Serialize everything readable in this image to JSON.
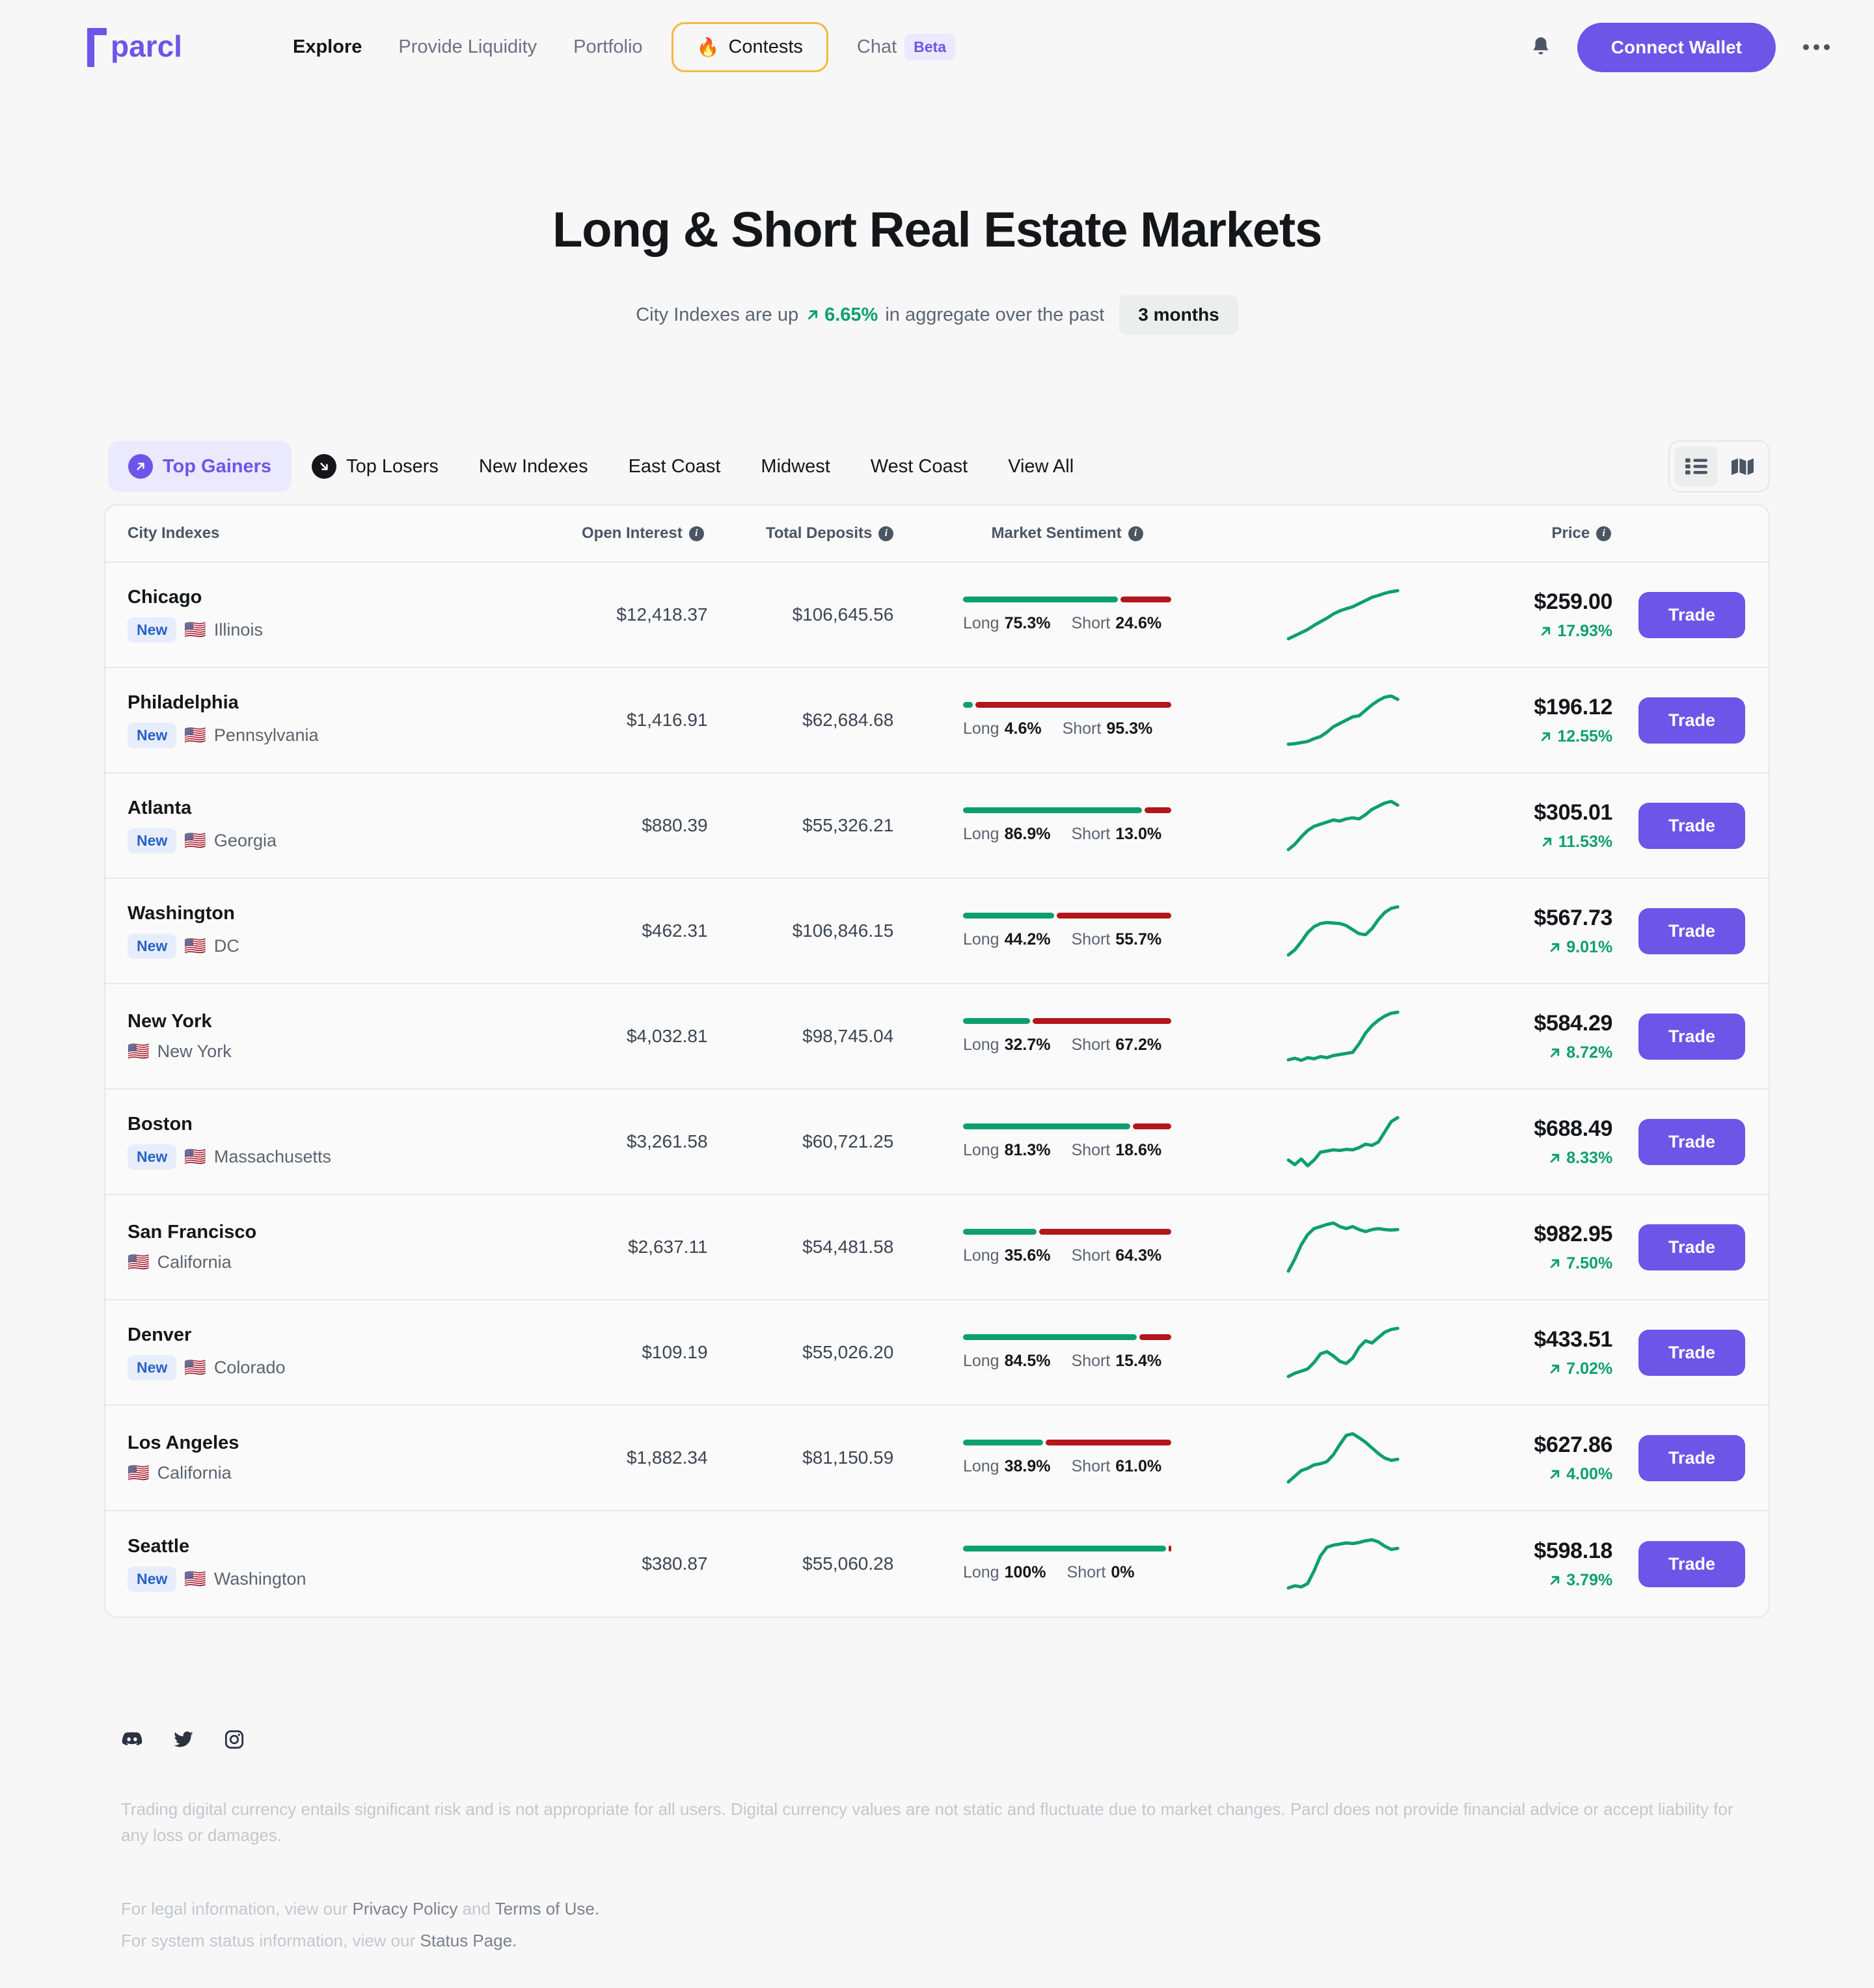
{
  "header": {
    "logo_text": "parcl",
    "nav": [
      {
        "label": "Explore",
        "active": true
      },
      {
        "label": "Provide Liquidity",
        "active": false
      },
      {
        "label": "Portfolio",
        "active": false
      }
    ],
    "contests_label": "Contests",
    "contests_icon": "flame-icon",
    "chat_label": "Chat",
    "chat_badge": "Beta",
    "notifications_icon": "bell-icon",
    "connect_wallet_label": "Connect Wallet",
    "overflow_icon": "ellipsis-icon",
    "brand_color": "#6d55e8",
    "contest_border_color": "#f5b841"
  },
  "hero": {
    "title": "Long & Short Real Estate Markets",
    "subtitle_prefix": "City Indexes are up",
    "subtitle_change": "6.65%",
    "subtitle_middle": "in aggregate over the past",
    "period": "3 months",
    "up_color": "#0e9f6e"
  },
  "filters": {
    "tabs": [
      {
        "label": "Top Gainers",
        "icon": "arrow-up-right-circle-icon",
        "active": true
      },
      {
        "label": "Top Losers",
        "icon": "arrow-down-right-circle-icon",
        "active": false
      },
      {
        "label": "New Indexes",
        "icon": null,
        "active": false
      },
      {
        "label": "East Coast",
        "icon": null,
        "active": false
      },
      {
        "label": "Midwest",
        "icon": null,
        "active": false
      },
      {
        "label": "West Coast",
        "icon": null,
        "active": false
      },
      {
        "label": "View All",
        "icon": null,
        "active": false
      }
    ],
    "view_list_icon": "list-view-icon",
    "view_map_icon": "map-view-icon",
    "view_active": "list"
  },
  "table": {
    "columns": [
      {
        "label": "City Indexes",
        "info": false
      },
      {
        "label": "Open Interest",
        "info": true
      },
      {
        "label": "Total Deposits",
        "info": true
      },
      {
        "label": "Market Sentiment",
        "info": true
      },
      {
        "label": "Price",
        "info": true
      }
    ],
    "long_label": "Long",
    "short_label": "Short",
    "new_badge_label": "New",
    "flag_icon": "us-flag-icon",
    "trade_label": "Trade",
    "rows": [
      {
        "city": "Chicago",
        "is_new": true,
        "state": "Illinois",
        "open_interest": "$12,418.37",
        "total_deposits": "$106,645.56",
        "long_pct": "75.3%",
        "short_pct": "24.6%",
        "long_val": 75.3,
        "short_val": 24.6,
        "price": "$259.00",
        "change": "17.93%",
        "trend": "up",
        "spark": [
          4,
          10,
          16,
          22,
          30,
          37,
          44,
          52,
          58,
          62,
          66,
          72,
          78,
          84,
          88,
          92,
          95,
          97
        ]
      },
      {
        "city": "Philadelphia",
        "is_new": true,
        "state": "Pennsylvania",
        "open_interest": "$1,416.91",
        "total_deposits": "$62,684.68",
        "long_pct": "4.6%",
        "short_pct": "95.3%",
        "long_val": 4.6,
        "short_val": 95.3,
        "price": "$196.12",
        "change": "12.55%",
        "trend": "up",
        "spark": [
          8,
          9,
          11,
          13,
          18,
          22,
          30,
          40,
          46,
          52,
          58,
          60,
          70,
          80,
          88,
          94,
          96,
          90
        ]
      },
      {
        "city": "Atlanta",
        "is_new": true,
        "state": "Georgia",
        "open_interest": "$880.39",
        "total_deposits": "$55,326.21",
        "long_pct": "86.9%",
        "short_pct": "13.0%",
        "long_val": 86.9,
        "short_val": 13.0,
        "price": "$305.01",
        "change": "11.53%",
        "trend": "up",
        "spark": [
          6,
          16,
          30,
          42,
          50,
          54,
          58,
          62,
          60,
          64,
          66,
          64,
          72,
          82,
          88,
          94,
          97,
          90
        ]
      },
      {
        "city": "Washington",
        "is_new": true,
        "state": "DC",
        "open_interest": "$462.31",
        "total_deposits": "$106,846.15",
        "long_pct": "44.2%",
        "short_pct": "55.7%",
        "long_val": 44.2,
        "short_val": 55.7,
        "price": "$567.73",
        "change": "9.01%",
        "trend": "up",
        "spark": [
          4,
          14,
          30,
          48,
          60,
          66,
          68,
          67,
          66,
          62,
          54,
          46,
          44,
          56,
          74,
          88,
          96,
          99
        ]
      },
      {
        "city": "New York",
        "is_new": false,
        "state": "New York",
        "open_interest": "$4,032.81",
        "total_deposits": "$98,745.04",
        "long_pct": "32.7%",
        "short_pct": "67.2%",
        "long_val": 32.7,
        "short_val": 67.2,
        "price": "$584.29",
        "change": "8.72%",
        "trend": "up",
        "spark": [
          10,
          13,
          9,
          14,
          12,
          16,
          14,
          18,
          20,
          22,
          24,
          40,
          60,
          74,
          84,
          92,
          97,
          99
        ]
      },
      {
        "city": "Boston",
        "is_new": true,
        "state": "Massachusetts",
        "open_interest": "$3,261.58",
        "total_deposits": "$60,721.25",
        "long_pct": "81.3%",
        "short_pct": "18.6%",
        "long_val": 81.3,
        "short_val": 18.6,
        "price": "$688.49",
        "change": "8.33%",
        "trend": "up",
        "spark": [
          24,
          16,
          26,
          14,
          24,
          38,
          40,
          42,
          41,
          43,
          42,
          46,
          52,
          50,
          56,
          74,
          92,
          99
        ]
      },
      {
        "city": "San Francisco",
        "is_new": false,
        "state": "California",
        "open_interest": "$2,637.11",
        "total_deposits": "$54,481.58",
        "long_pct": "35.6%",
        "short_pct": "64.3%",
        "long_val": 35.6,
        "short_val": 64.3,
        "price": "$982.95",
        "change": "7.50%",
        "trend": "up",
        "spark": [
          4,
          28,
          56,
          76,
          88,
          92,
          96,
          99,
          92,
          88,
          92,
          86,
          82,
          86,
          88,
          86,
          85,
          86
        ]
      },
      {
        "city": "Denver",
        "is_new": true,
        "state": "Colorado",
        "open_interest": "$109.19",
        "total_deposits": "$55,026.20",
        "long_pct": "84.5%",
        "short_pct": "15.4%",
        "long_val": 84.5,
        "short_val": 15.4,
        "price": "$433.51",
        "change": "7.02%",
        "trend": "up",
        "spark": [
          10,
          16,
          20,
          24,
          36,
          52,
          56,
          48,
          38,
          34,
          44,
          64,
          76,
          72,
          82,
          92,
          97,
          99
        ]
      },
      {
        "city": "Los Angeles",
        "is_new": false,
        "state": "California",
        "open_interest": "$1,882.34",
        "total_deposits": "$81,150.59",
        "long_pct": "38.9%",
        "short_pct": "61.0%",
        "long_val": 38.9,
        "short_val": 61.0,
        "price": "$627.86",
        "change": "4.00%",
        "trend": "up",
        "spark": [
          14,
          24,
          34,
          38,
          44,
          46,
          50,
          62,
          80,
          96,
          99,
          92,
          84,
          74,
          64,
          56,
          52,
          54
        ]
      },
      {
        "city": "Seattle",
        "is_new": true,
        "state": "Washington",
        "open_interest": "$380.87",
        "total_deposits": "$55,060.28",
        "long_pct": "100%",
        "short_pct": "0%",
        "long_val": 100,
        "short_val": 0.6,
        "price": "$598.18",
        "change": "3.79%",
        "trend": "up",
        "spark": [
          8,
          12,
          10,
          16,
          40,
          68,
          84,
          88,
          90,
          92,
          91,
          93,
          96,
          98,
          94,
          86,
          80,
          82
        ]
      }
    ]
  },
  "footer": {
    "socials": [
      {
        "name": "discord-icon"
      },
      {
        "name": "twitter-icon"
      },
      {
        "name": "instagram-icon"
      }
    ],
    "disclaimer": "Trading digital currency entails significant risk and is not appropriate for all users. Digital currency values are not static and fluctuate due to market changes. Parcl does not provide financial advice or accept liability for any loss or damages.",
    "legal_prefix": "For legal information, view our",
    "privacy_label": "Privacy Policy",
    "legal_and": "and",
    "terms_label": "Terms of Use.",
    "status_prefix": "For system status information, view our",
    "status_label": "Status Page."
  }
}
